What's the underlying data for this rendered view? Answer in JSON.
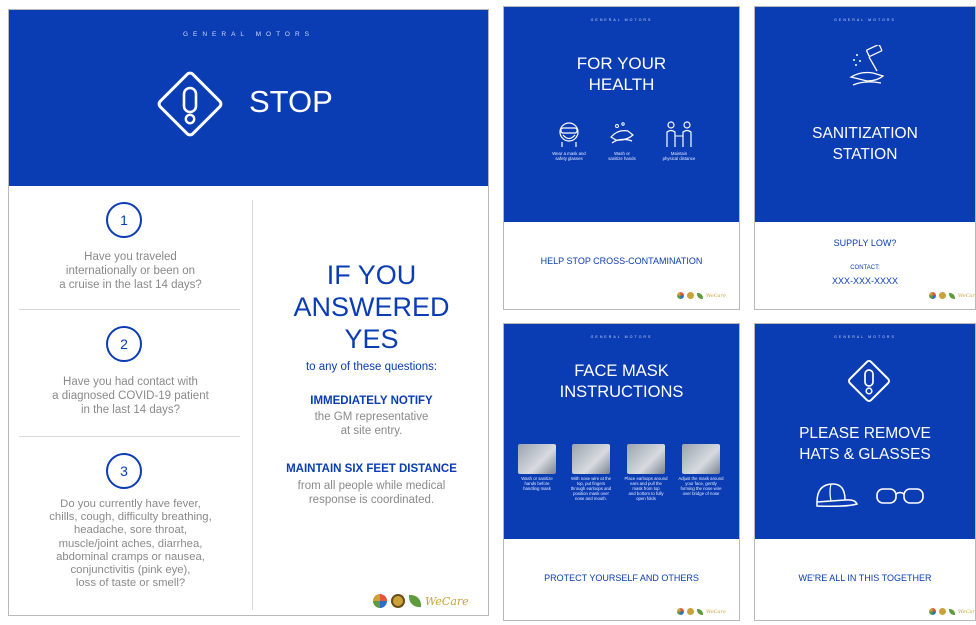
{
  "brand": "GENERAL MOTORS",
  "logos": {
    "wecare": "WeCare",
    "colors": [
      "#e2543b",
      "#c9a23a",
      "#5d9b3d",
      "#2b6cc7"
    ]
  },
  "main": {
    "title": "STOP",
    "questions": [
      {
        "num": "1",
        "text": [
          "Have you traveled",
          "internationally or been on",
          "a cruise in the last 14 days?"
        ]
      },
      {
        "num": "2",
        "text": [
          "Have you had contact with",
          "a diagnosed COVID-19 patient",
          "in the last 14 days?"
        ]
      },
      {
        "num": "3",
        "text": [
          "Do you currently have fever,",
          "chills, cough, difficulty breathing,",
          "headache, sore throat,",
          "muscle/joint aches, diarrhea,",
          "abdominal cramps or nausea,",
          "conjunctivitis (pink eye),",
          "loss of taste or smell?"
        ]
      }
    ],
    "answer_lines": [
      "IF YOU",
      "ANSWERED",
      "YES"
    ],
    "answer_sub": "to any of these questions:",
    "notify_head": "IMMEDIATELY NOTIFY",
    "notify_text": [
      "the GM representative",
      "at site entry."
    ],
    "distance_head": "MAINTAIN SIX FEET DISTANCE",
    "distance_text": [
      "from all people while medical",
      "response is coordinated."
    ]
  },
  "health": {
    "title": [
      "FOR YOUR",
      "HEALTH"
    ],
    "icons": [
      {
        "icon": "mask-goggles-icon",
        "caption": [
          "Wear a mask and",
          "safety glasses"
        ]
      },
      {
        "icon": "wash-hands-icon",
        "caption": [
          "Wash or",
          "sanitize hands"
        ]
      },
      {
        "icon": "distance-icon",
        "caption": [
          "Maintain",
          "physical distance"
        ]
      }
    ],
    "footer": "HELP STOP CROSS-CONTAMINATION"
  },
  "sanitization": {
    "title": [
      "SANITIZATION",
      "STATION"
    ],
    "supply": "SUPPLY LOW?",
    "contact_label": "CONTACT:",
    "phone": "XXX-XXX-XXXX"
  },
  "facemask": {
    "title": [
      "FACE MASK",
      "INSTRUCTIONS"
    ],
    "steps": [
      [
        "Wash or sanitize",
        "hands before",
        "handling mask"
      ],
      [
        "With nose wire at the",
        "top, put fingers",
        "through earloops and",
        "position mask over",
        "nose and mouth."
      ],
      [
        "Place earloops around",
        "ears and pull the",
        "mask from top",
        "and bottom to fully",
        "open folds"
      ],
      [
        "Adjust the mask around",
        "your face, gently",
        "forming the nose wire",
        "over bridge of nose"
      ]
    ],
    "footer": "PROTECT YOURSELF AND OTHERS"
  },
  "remove": {
    "title": [
      "PLEASE REMOVE",
      "HATS & GLASSES"
    ],
    "footer": "WE'RE ALL IN THIS TOGETHER"
  },
  "colors": {
    "gm_blue": "#0a3cb4",
    "text_grey": "#8a8a8a",
    "divider": "#d8d8d8"
  }
}
